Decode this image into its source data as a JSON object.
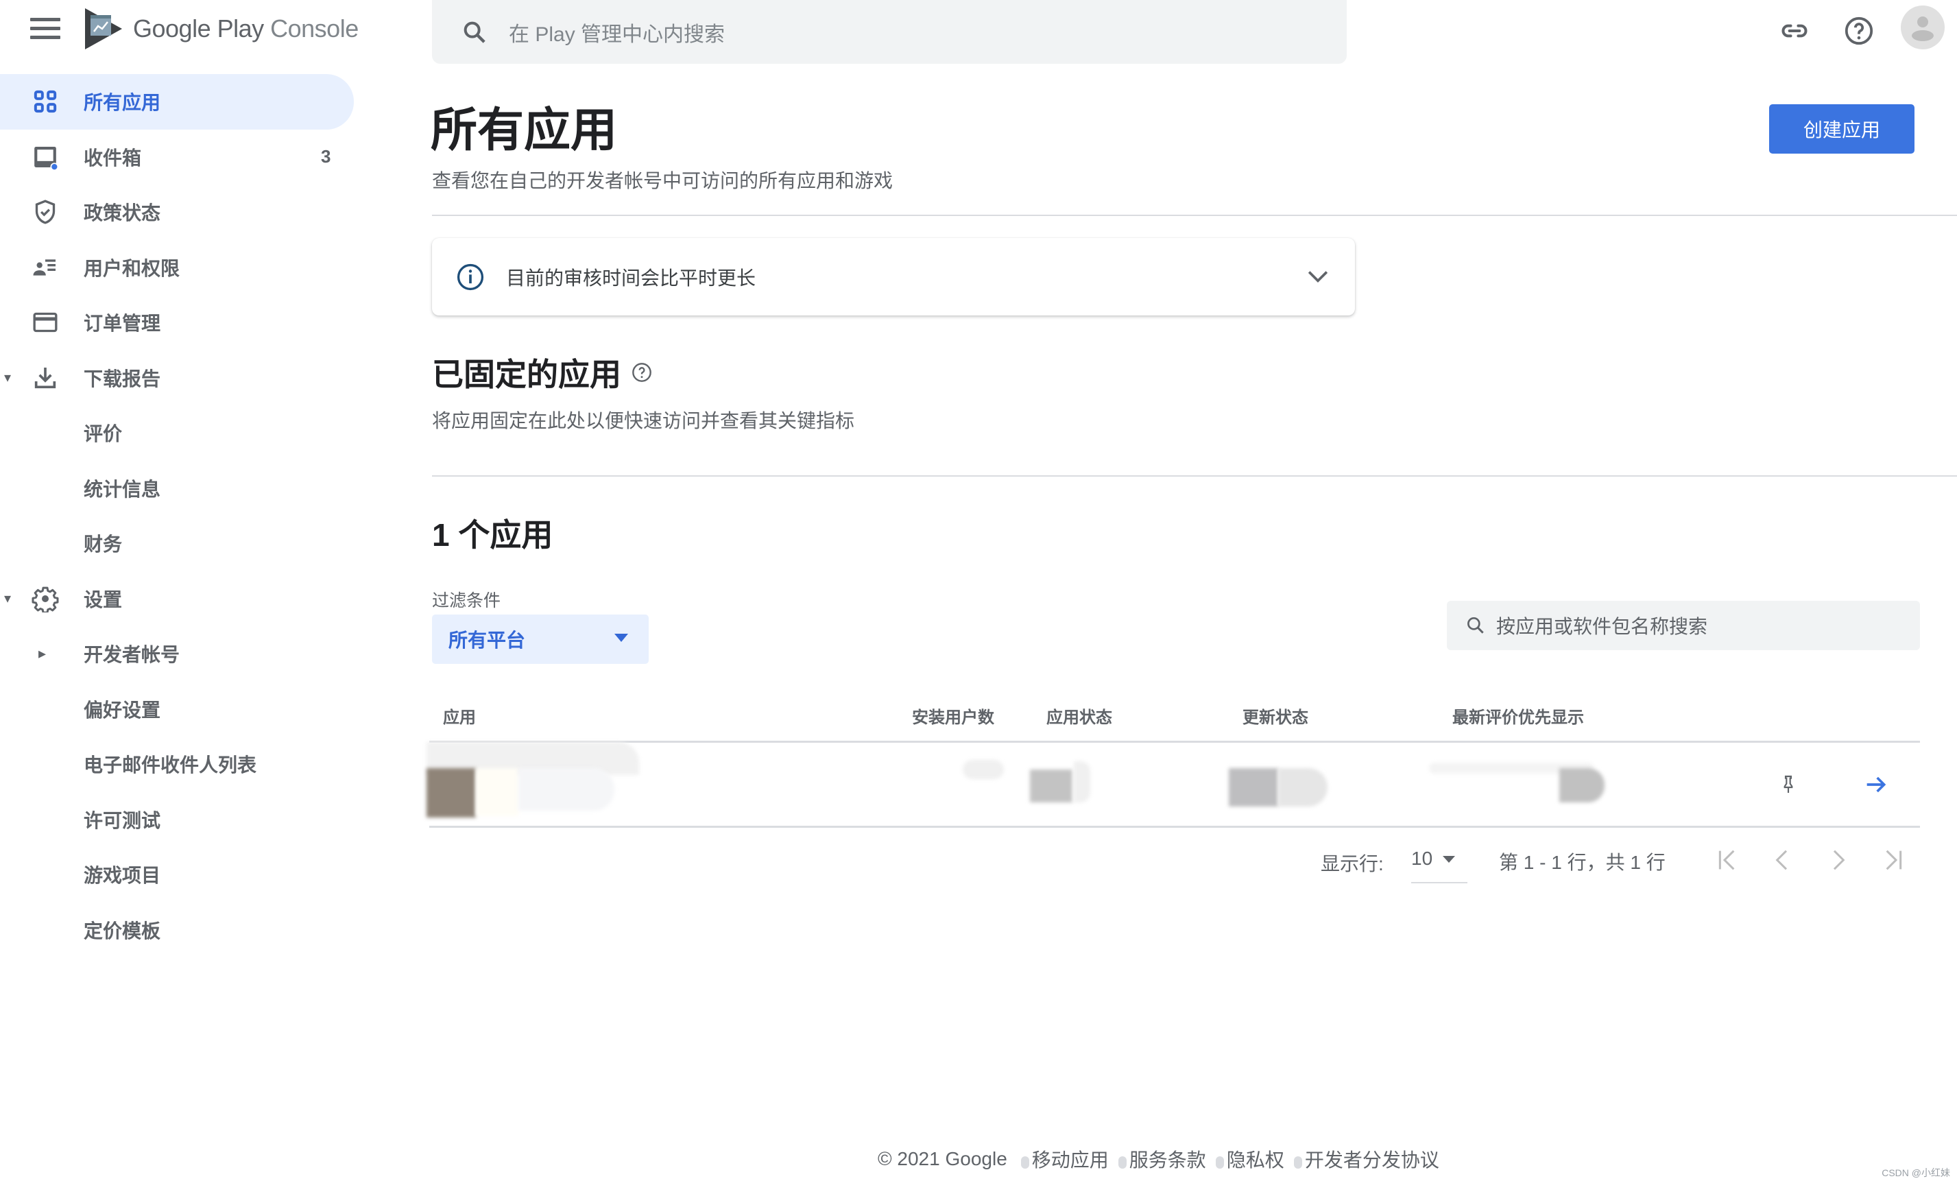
{
  "app": {
    "title_brand": "Google Play",
    "title_product": "Console"
  },
  "topbar": {
    "search_placeholder": "在 Play 管理中心内搜索",
    "icons": [
      "link-icon",
      "help-icon",
      "account-avatar"
    ]
  },
  "sidebar": {
    "items": [
      {
        "label": "所有应用",
        "icon": "apps-grid-icon",
        "active": true
      },
      {
        "label": "收件箱",
        "icon": "inbox-icon",
        "badge": "3"
      },
      {
        "label": "政策状态",
        "icon": "shield-check-icon"
      },
      {
        "label": "用户和权限",
        "icon": "user-list-icon"
      },
      {
        "label": "订单管理",
        "icon": "credit-card-icon"
      },
      {
        "label": "下载报告",
        "icon": "download-icon",
        "expanded": true
      },
      {
        "label": "评价",
        "child": true
      },
      {
        "label": "统计信息",
        "child": true
      },
      {
        "label": "财务",
        "child": true
      },
      {
        "label": "设置",
        "icon": "gear-icon",
        "expanded": true
      },
      {
        "label": "开发者帐号",
        "child": true,
        "collapsed": true
      },
      {
        "label": "偏好设置",
        "child": true
      },
      {
        "label": "电子邮件收件人列表",
        "child": true
      },
      {
        "label": "许可测试",
        "child": true
      },
      {
        "label": "游戏项目",
        "child": true
      },
      {
        "label": "定价模板",
        "child": true
      }
    ]
  },
  "main": {
    "title": "所有应用",
    "subtitle": "查看您在自己的开发者帐号中可访问的所有应用和游戏",
    "create_button": "创建应用",
    "notice": {
      "text": "目前的审核时间会比平时更长"
    },
    "pinned": {
      "title": "已固定的应用",
      "description": "将应用固定在此处以便快速访问并查看其关键指标"
    },
    "apps": {
      "count_title": "1 个应用",
      "filter_label": "过滤条件",
      "filter_value": "所有平台",
      "search_placeholder": "按应用或软件包名称搜索",
      "columns": [
        "应用",
        "安装用户数",
        "应用状态",
        "更新状态",
        "最新评价优先显示"
      ],
      "rows": [
        {
          "app": "",
          "installs": "",
          "app_status": "",
          "update_status": "",
          "latest_review": "",
          "redacted": true
        }
      ]
    },
    "pagination": {
      "rows_label": "显示行:",
      "rows_value": "10",
      "range_text": "第 1 - 1 行，共 1 行"
    }
  },
  "footer": {
    "copyright": "© 2021 Google",
    "links": [
      "移动应用",
      "服务条款",
      "隐私权",
      "开发者分发协议"
    ]
  },
  "watermark": "CSDN @小红妹",
  "colors": {
    "accent": "#3b74e0",
    "active_bg": "#e8f0fe",
    "active_text": "#3367d6",
    "text_secondary": "#5f6368",
    "divider": "#dadce0",
    "search_bg": "#f1f3f4"
  }
}
